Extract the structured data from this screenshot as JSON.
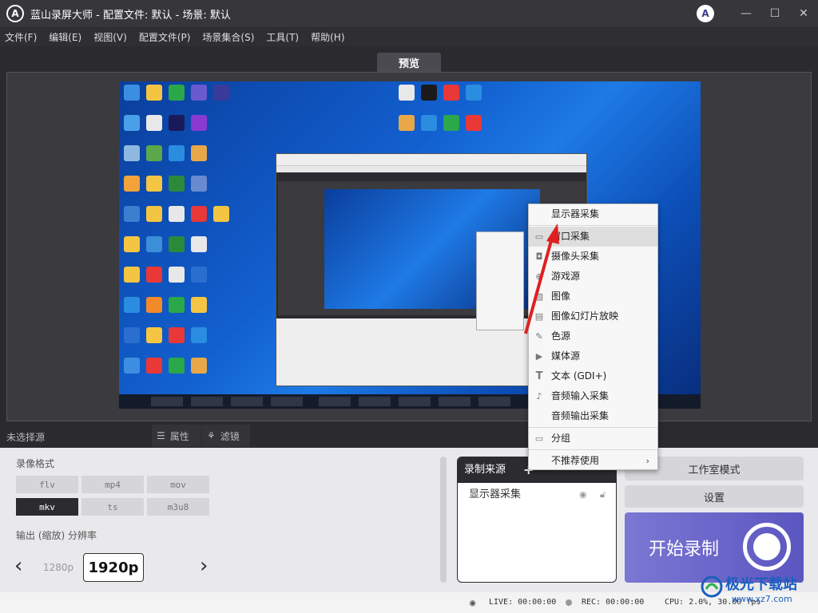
{
  "app": {
    "title": "蓝山录屏大师 - 配置文件: 默认 - 场景: 默认",
    "logo_letter": "A"
  },
  "window_controls": {
    "minimize": "—",
    "maximize": "☐",
    "close": "✕"
  },
  "menu": [
    "文件(F)",
    "编辑(E)",
    "视图(V)",
    "配置文件(P)",
    "场景集合(S)",
    "工具(T)",
    "帮助(H)"
  ],
  "preview_tab": "预览",
  "context_menu": {
    "items": [
      {
        "label": "显示器采集",
        "icon": ""
      },
      {
        "label": "窗口采集",
        "icon": "window-icon",
        "highlight": true
      },
      {
        "label": "摄像头采集",
        "icon": "camera-icon"
      },
      {
        "label": "游戏源",
        "icon": "gamepad-icon"
      },
      {
        "label": "图像",
        "icon": "image-icon"
      },
      {
        "label": "图像幻灯片放映",
        "icon": "slideshow-icon"
      },
      {
        "label": "色源",
        "icon": "brush-icon"
      },
      {
        "label": "媒体源",
        "icon": "play-icon"
      },
      {
        "label": "文本 (GDI+)",
        "icon": "text-icon"
      },
      {
        "label": "音频输入采集",
        "icon": "mic-icon"
      },
      {
        "label": "音频输出采集",
        "icon": ""
      },
      {
        "label": "分组",
        "icon": "folder-icon"
      },
      {
        "label": "不推荐使用",
        "icon": "",
        "submenu": true
      }
    ]
  },
  "source_bar": {
    "no_source": "未选择源",
    "properties": "属性",
    "filters": "滤镜"
  },
  "record_format": {
    "label": "录像格式",
    "formats": [
      "flv",
      "mp4",
      "mov",
      "mkv",
      "ts",
      "m3u8"
    ],
    "selected": "mkv"
  },
  "resolution": {
    "label": "输出 (缩放) 分辨率",
    "prev": "1280p",
    "current": "1920p"
  },
  "record_sources": {
    "title": "录制来源",
    "add": "+",
    "items": [
      {
        "label": "显示器采集"
      }
    ]
  },
  "buttons": {
    "studio_mode": "工作室模式",
    "settings": "设置",
    "start_record": "开始录制"
  },
  "status": {
    "live": "LIVE: 00:00:00",
    "rec": "REC: 00:00:00",
    "cpu": "CPU: 2.0%, 30.00 fps"
  },
  "watermark": {
    "text": "极光下载站",
    "url": "www.xz7.com"
  },
  "colors": {
    "accent": "#5b56c0",
    "dark": "#2b2b30",
    "highlight_arrow": "#e02020"
  }
}
